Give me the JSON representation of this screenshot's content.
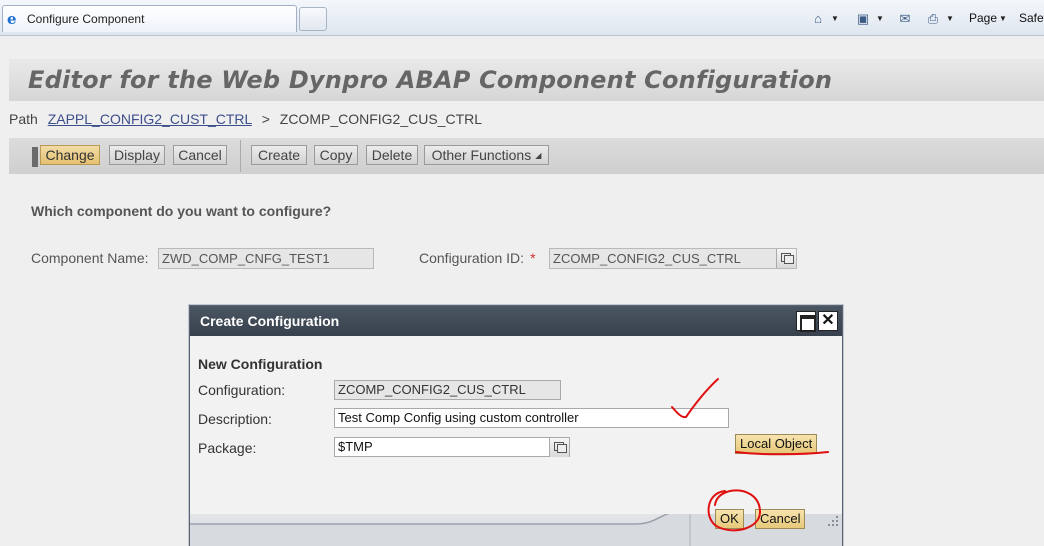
{
  "browser": {
    "tab_title": "Configure Component",
    "commands": {
      "home": "home-icon",
      "feeds": "feeds-icon",
      "read_mail": "mail-icon",
      "print": "print-icon",
      "page_label": "Page",
      "safety_label": "Safet"
    }
  },
  "page": {
    "title": "Editor for the Web Dynpro ABAP Component Configuration",
    "path_label": "Path",
    "path_link": "ZAPPL_CONFIG2_CUST_CTRL",
    "path_separator": ">",
    "path_current": "ZCOMP_CONFIG2_CUS_CTRL"
  },
  "toolbar": {
    "change": "Change",
    "display": "Display",
    "cancel": "Cancel",
    "create": "Create",
    "copy": "Copy",
    "delete": "Delete",
    "other_functions": "Other Functions"
  },
  "form": {
    "question": "Which component do you want to configure?",
    "component_label": "Component Name:",
    "component_value": "ZWD_COMP_CNFG_TEST1",
    "config_id_label": "Configuration ID:",
    "required_mark": "*",
    "config_id_value": "ZCOMP_CONFIG2_CUS_CTRL"
  },
  "dialog": {
    "title": "Create Configuration",
    "section": "New Configuration",
    "configuration_label": "Configuration:",
    "configuration_value": "ZCOMP_CONFIG2_CUS_CTRL",
    "description_label": "Description:",
    "description_value": "Test Comp Config using custom  controller",
    "package_label": "Package:",
    "package_value": "$TMP",
    "local_object": "Local Object",
    "ok": "OK",
    "cancel": "Cancel",
    "close_symbol": "✕"
  },
  "colors": {
    "annotation": "#e01010",
    "active_button": "#e8c97a",
    "dialog_header": "#3e4956"
  }
}
